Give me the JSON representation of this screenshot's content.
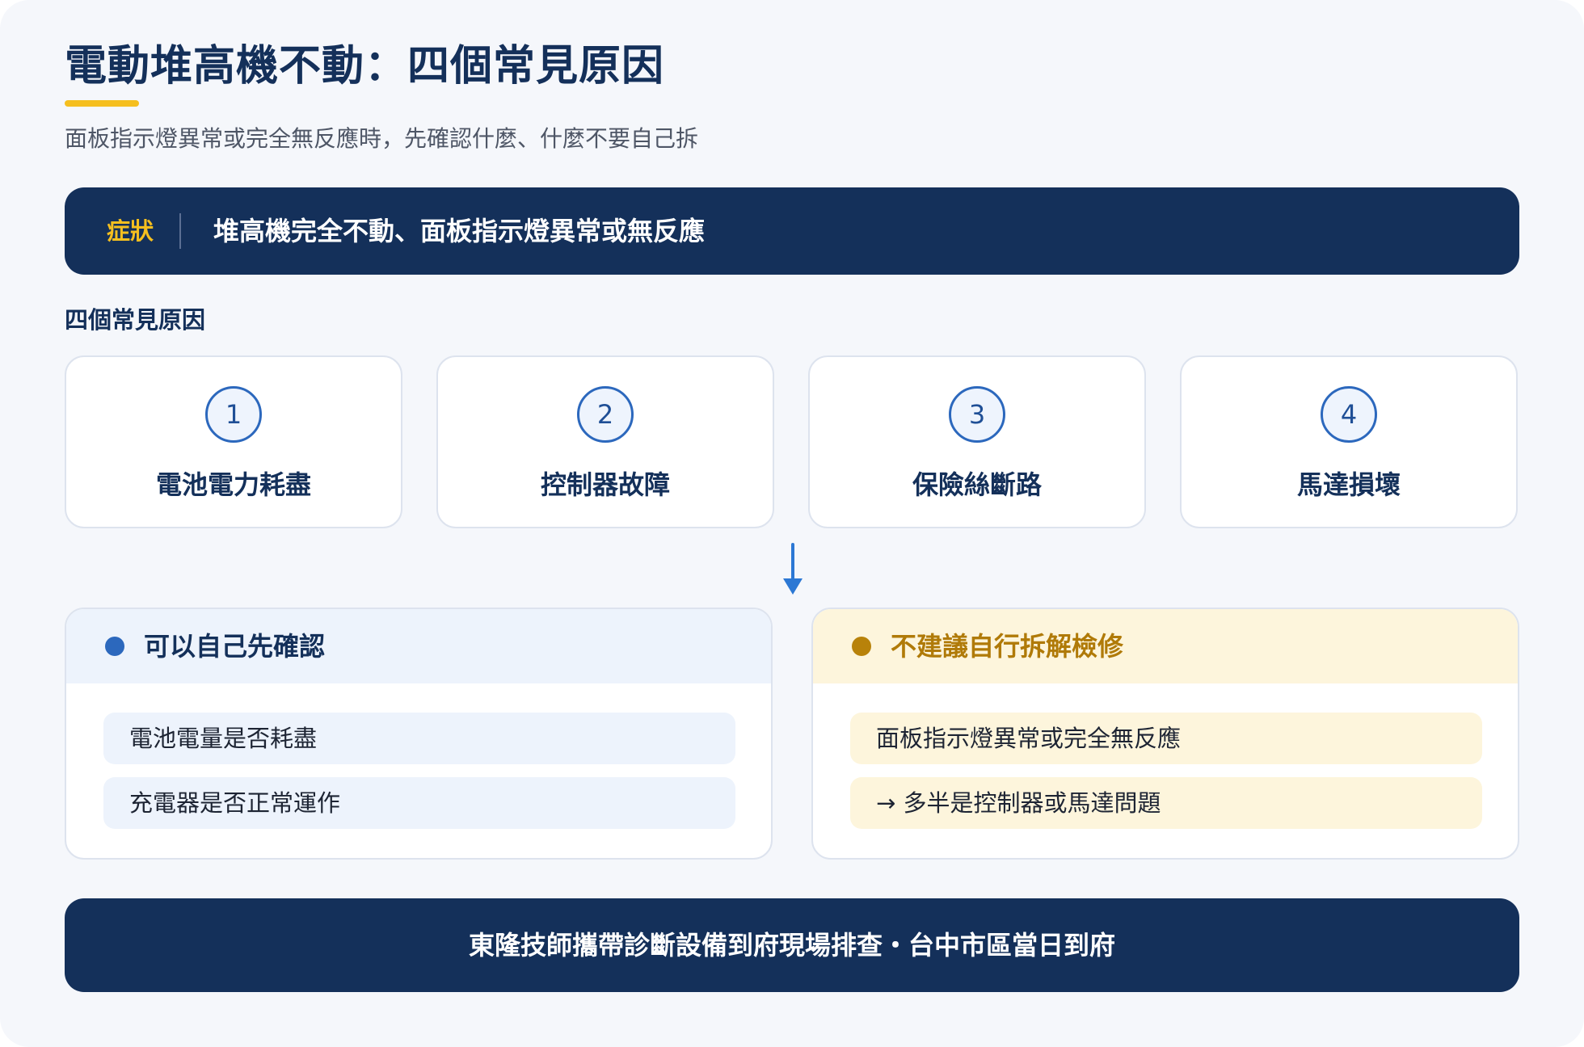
{
  "header": {
    "title": "電動堆高機不動：四個常見原因",
    "subtitle": "面板指示燈異常或完全無反應時，先確認什麼、什麼不要自己拆"
  },
  "symptom": {
    "tag": "症狀",
    "text": "堆高機完全不動、面板指示燈異常或無反應"
  },
  "causes": {
    "section_label": "四個常見原因",
    "items": [
      {
        "number": "1",
        "label": "電池電力耗盡"
      },
      {
        "number": "2",
        "label": "控制器故障"
      },
      {
        "number": "3",
        "label": "保險絲斷路"
      },
      {
        "number": "4",
        "label": "馬達損壞"
      }
    ]
  },
  "self_check": {
    "title": "可以自己先確認",
    "items": [
      "電池電量是否耗盡",
      "充電器是否正常運作"
    ]
  },
  "no_diy": {
    "title": "不建議自行拆解檢修",
    "items": [
      "面板指示燈異常或完全無反應",
      "→ 多半是控制器或馬達問題"
    ]
  },
  "footer": {
    "text": "東隆技師攜帶診斷設備到府現場排查・台中市區當日到府"
  },
  "colors": {
    "navy": "#14305a",
    "accent_yellow": "#f5bf1f",
    "blue": "#2c68bd",
    "amber": "#b8820a",
    "self_check_header": "#edf3fc",
    "no_diy_header": "#fdf5dc"
  },
  "icons": {
    "flow_arrow": "arrow-down-icon"
  }
}
